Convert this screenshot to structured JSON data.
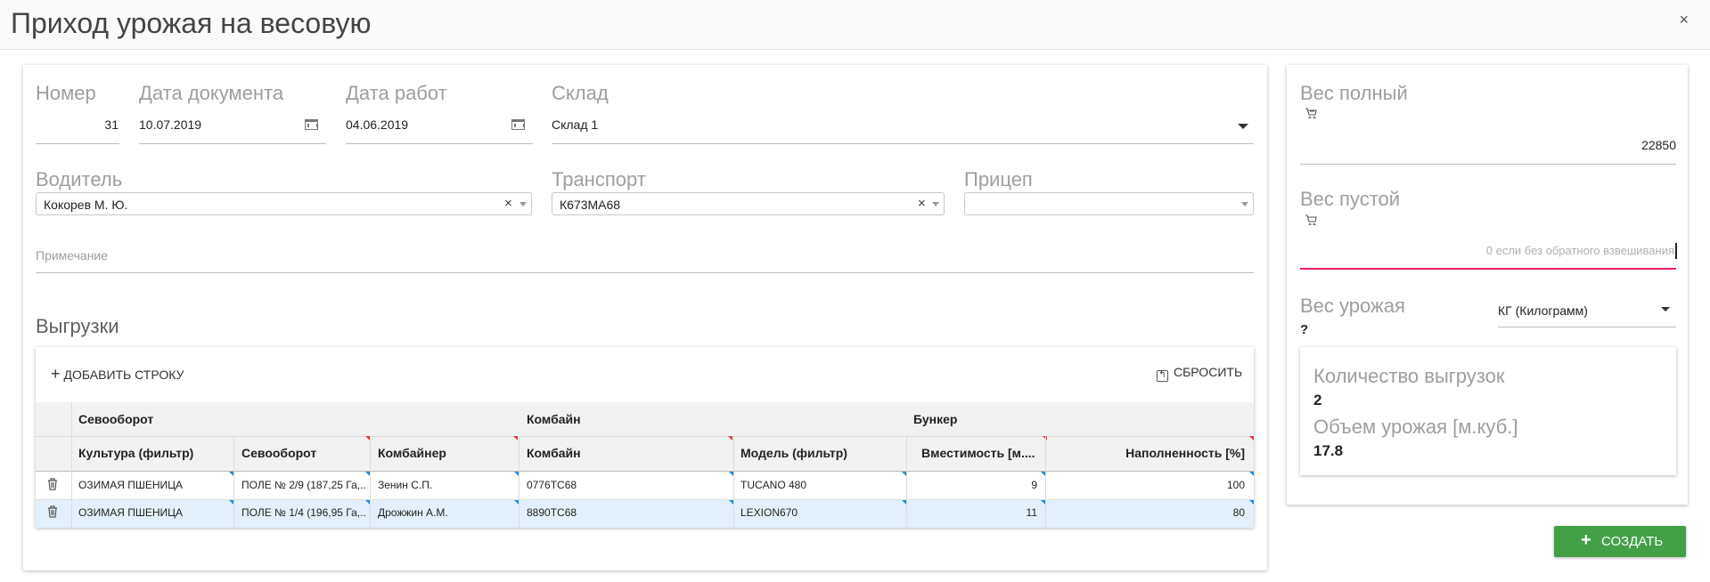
{
  "window": {
    "title": "Приход урожая на весовую",
    "close": "×"
  },
  "form": {
    "number_label": "Номер",
    "number_value": "31",
    "doc_date_label": "Дата документа",
    "doc_date_value": "10.07.2019",
    "work_date_label": "Дата работ",
    "work_date_value": "04.06.2019",
    "warehouse_label": "Склад",
    "warehouse_value": "Склад 1",
    "driver_label": "Водитель",
    "driver_value": "Кокорев М. Ю.",
    "transport_label": "Транспорт",
    "transport_value": "К673МА68",
    "trailer_label": "Прицеп",
    "trailer_value": "",
    "note_placeholder": "Примечание",
    "clear": "×"
  },
  "unloads": {
    "title": "Выгрузки",
    "add_row": "ДОБАВИТЬ СТРОКУ",
    "reset": "СБРОСИТЬ",
    "groups": [
      "Севооборот",
      "Комбайн",
      "Бункер"
    ],
    "columns": [
      "Культура (фильтр)",
      "Севооборот",
      "Комбайнер",
      "Комбайн",
      "Модель (фильтр)",
      "Вместимость [м....",
      "Наполненность [%]"
    ],
    "rows": [
      {
        "culture": "ОЗИМАЯ ПШЕНИЦА",
        "rotation": "ПОЛЕ № 2/9 (187,25 Га,...",
        "operator": "Зенин С.П.",
        "combine": "0776ТС68",
        "model": "TUCANO 480",
        "capacity": "9",
        "fill": "100"
      },
      {
        "culture": "ОЗИМАЯ ПШЕНИЦА",
        "rotation": "ПОЛЕ № 1/4 (196,95 Га,...",
        "operator": "Дрожжин А.М.",
        "combine": "8890ТС68",
        "model": "LEXION670",
        "capacity": "11",
        "fill": "80"
      }
    ]
  },
  "weights": {
    "full_label": "Вес полный",
    "full_value": "22850",
    "empty_label": "Вес пустой",
    "empty_placeholder": "0 если без обратного взвешивания",
    "harvest_label": "Вес урожая",
    "harvest_value": "?",
    "unit_value": "КГ (Килограмм)"
  },
  "summary": {
    "count_label": "Количество выгрузок",
    "count_value": "2",
    "volume_label": "Объем урожая [м.куб.]",
    "volume_value": "17.8"
  },
  "actions": {
    "create": "СОЗДАТЬ"
  },
  "colors": {
    "accent_underline": "#e91e63",
    "create_button": "#43a047",
    "selected_row": "#e3f0fb",
    "required_marker": "#e53935",
    "editable_marker": "#1e88e5"
  }
}
